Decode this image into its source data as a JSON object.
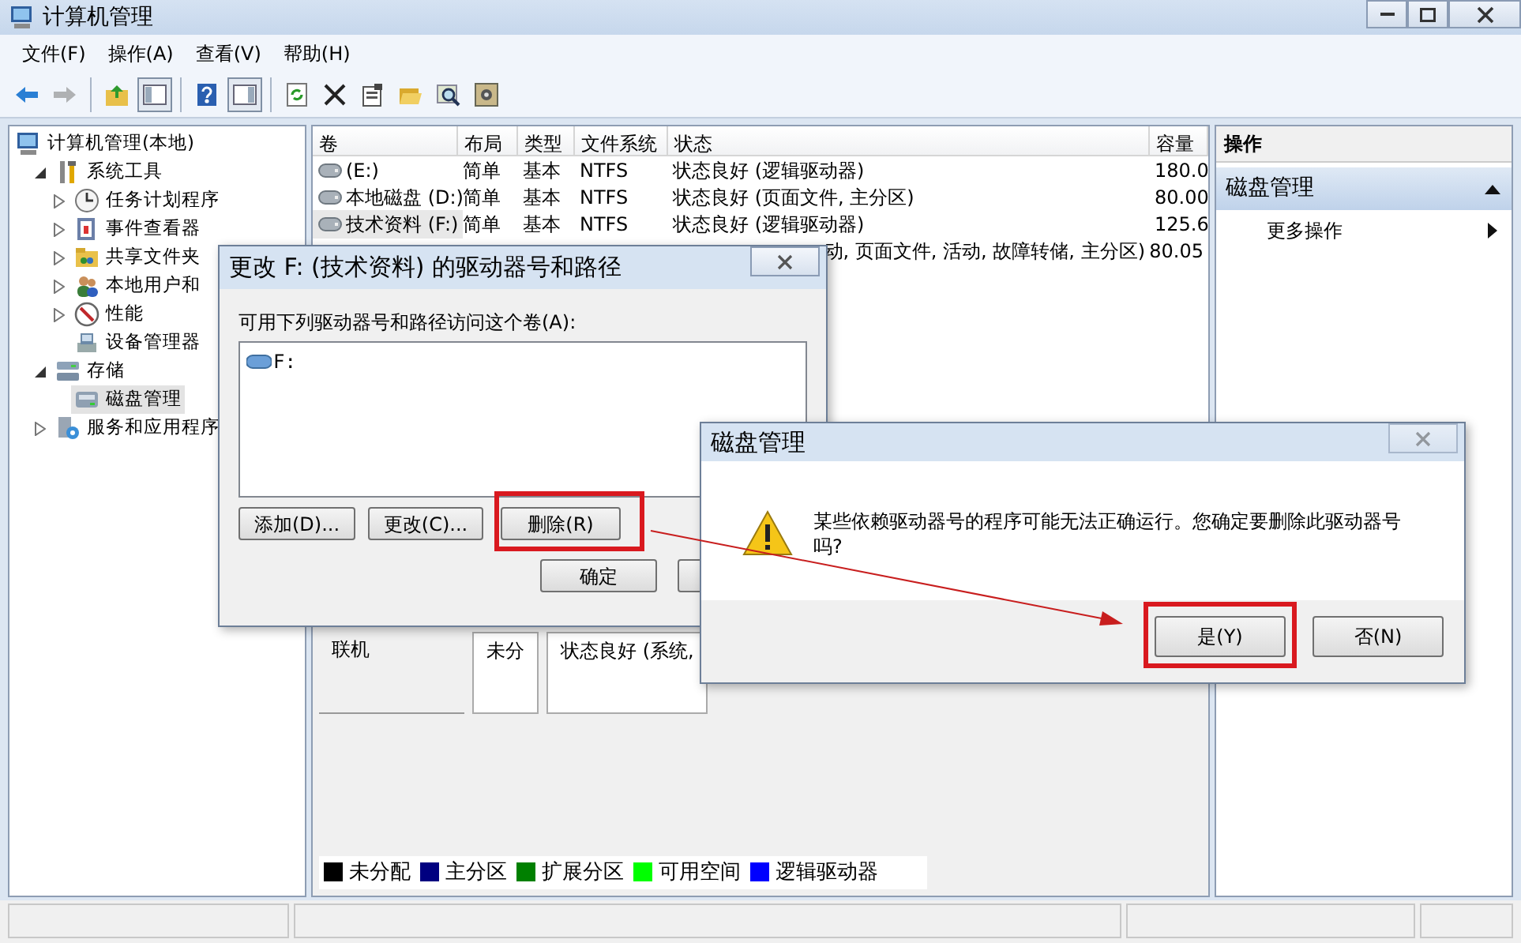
{
  "window": {
    "title": "计算机管理"
  },
  "menu": [
    "文件(F)",
    "操作(A)",
    "查看(V)",
    "帮助(H)"
  ],
  "toolbar": [
    [
      {
        "pressed": false,
        "disabled": false
      },
      {
        "pressed": false,
        "disabled": true
      }
    ],
    [
      {
        "pressed": false,
        "disabled": false
      },
      {
        "pressed": true,
        "disabled": false
      }
    ],
    [
      {
        "pressed": false,
        "disabled": false
      },
      {
        "pressed": true,
        "disabled": false
      }
    ],
    [
      {
        "pressed": false,
        "disabled": false
      },
      {
        "pressed": false,
        "disabled": false
      },
      {
        "pressed": false,
        "disabled": false
      },
      {
        "pressed": false,
        "disabled": false
      },
      {
        "pressed": false,
        "disabled": false
      },
      {
        "pressed": false,
        "disabled": false
      }
    ]
  ],
  "tree": [
    {
      "label": "计算机管理(本地)",
      "selected": false,
      "children": [
        {
          "label": "系统工具",
          "expanded": true,
          "selected": false,
          "children": [
            {
              "label": "任务计划程序",
              "expanded": false,
              "selected": false
            },
            {
              "label": "事件查看器",
              "expanded": false,
              "selected": false
            },
            {
              "label": "共享文件夹",
              "expanded": false,
              "selected": false
            },
            {
              "label": "本地用户和",
              "expanded": false,
              "selected": false
            },
            {
              "label": "性能",
              "expanded": false,
              "selected": false
            },
            {
              "label": "设备管理器",
              "selected": false
            }
          ]
        },
        {
          "label": "存储",
          "expanded": true,
          "selected": false,
          "children": [
            {
              "label": "磁盘管理",
              "selected": true
            }
          ]
        },
        {
          "label": "服务和应用程序",
          "expanded": false,
          "selected": false
        }
      ]
    }
  ],
  "table": {
    "columns": [
      "卷",
      "布局",
      "类型",
      "文件系统",
      "状态",
      "容量"
    ],
    "rows": [
      {
        "cells": [
          "(E:)",
          "简单",
          "基本",
          "NTFS",
          "状态良好 (逻辑驱动器)",
          "180.0"
        ],
        "selected": false,
        "covered": false
      },
      {
        "cells": [
          "本地磁盘 (D:)",
          "简单",
          "基本",
          "NTFS",
          "状态良好 (页面文件, 主分区)",
          "80.00"
        ],
        "selected": false,
        "covered": false
      },
      {
        "cells": [
          "技术资料 (F:)",
          "简单",
          "基本",
          "NTFS",
          "状态良好 (逻辑驱动器)",
          "125.6"
        ],
        "selected": true,
        "covered": false
      },
      {
        "cells": [
          null,
          null,
          null,
          null,
          "动, 页面文件, 活动, 故障转储, 主分区)",
          "80.05"
        ],
        "selected": false,
        "covered": true
      }
    ]
  },
  "disk_map": [
    {
      "kind": "disk",
      "text": "联机"
    },
    {
      "kind": "partition",
      "text": "未分"
    },
    {
      "kind": "partition",
      "text": "状态良好 (系统,"
    }
  ],
  "legend": [
    {
      "label": "未分配",
      "color": "#000000"
    },
    {
      "label": "主分区",
      "color": "#000080"
    },
    {
      "label": "扩展分区",
      "color": "#008000"
    },
    {
      "label": "可用空间",
      "color": "#00ff00"
    },
    {
      "label": "逻辑驱动器",
      "color": "#0000ff"
    }
  ],
  "actions": {
    "header": "操作",
    "sections": [
      {
        "title": "磁盘管理",
        "expanded": true,
        "items": [
          {
            "label": "更多操作",
            "submenu": true
          }
        ]
      }
    ]
  },
  "change_dialog": {
    "title": "更改 F: (技术资料) 的驱动器号和路径",
    "prompt": "可用下列驱动器号和路径访问这个卷(A):",
    "paths": [
      {
        "label": "F:"
      }
    ],
    "buttons": [
      {
        "label": "添加(D)...",
        "highlighted": false
      },
      {
        "label": "更改(C)...",
        "highlighted": false
      },
      {
        "label": "删除(R)",
        "highlighted": true
      }
    ],
    "ok": "确定"
  },
  "confirm_dialog": {
    "title": "磁盘管理",
    "close_disabled": true,
    "message": "某些依赖驱动器号的程序可能无法正确运行。您确定要删除此驱动器号吗?",
    "buttons": [
      {
        "label": "是(Y)",
        "highlighted": true
      },
      {
        "label": "否(N)",
        "highlighted": false
      }
    ]
  }
}
